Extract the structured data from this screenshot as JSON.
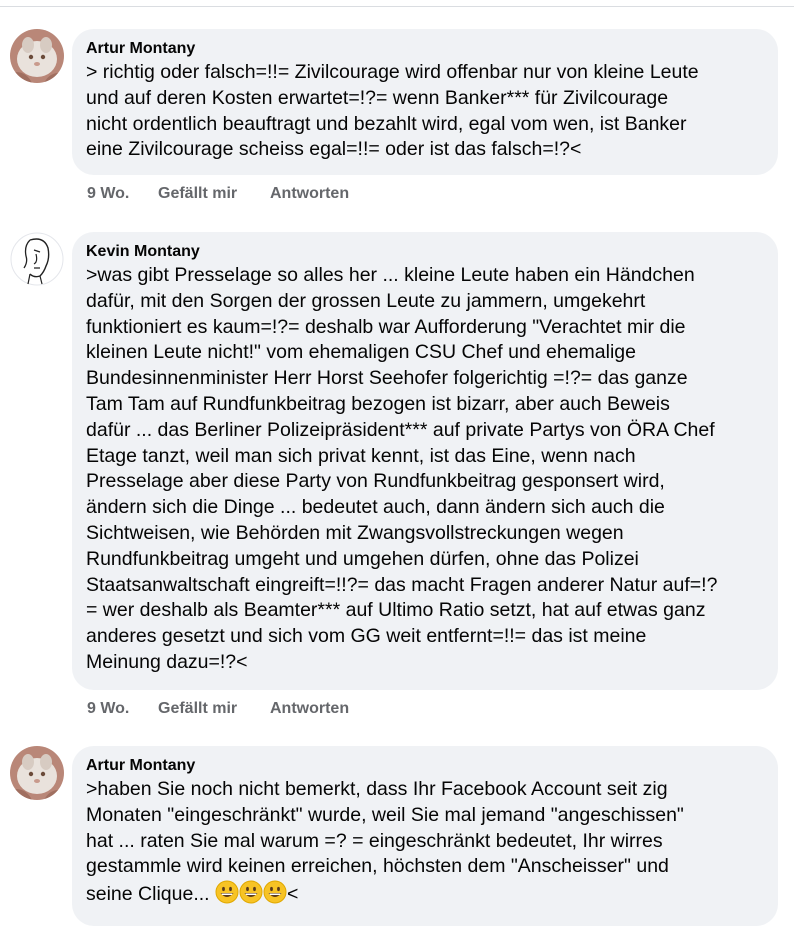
{
  "comments": [
    {
      "author": "Artur Montany",
      "text": "> richtig oder falsch=!!= Zivilcourage wird offenbar nur von kleine Leute\nund auf deren Kosten  erwartet=!?= wenn  Banker***  für Zivilcourage\nnicht ordentlich beauftragt und  bezahlt wird, egal vom wen,  ist Banker\neine Zivilcourage scheiss egal=!!= oder ist das falsch=!?<",
      "time": "9 Wo.",
      "like": "Gefällt mir",
      "reply": "Antworten"
    },
    {
      "author": "Kevin Montany",
      "text": ">was gibt Presselage so alles her ... kleine Leute haben ein Händchen\ndafür, mit den Sorgen der grossen Leute zu jammern, umgekehrt\nfunktioniert es kaum=!?= deshalb war Aufforderung \"Verachtet mir die\nkleinen Leute nicht!\" vom ehemaligen CSU Chef und ehemalige\nBundesinnenminister Herr Horst Seehofer folgerichtig =!?= das ganze\nTam Tam auf Rundfunkbeitrag bezogen ist bizarr, aber auch Beweis\ndafür ... das Berliner Polizeipräsident*** auf private Partys von ÖRA Chef\nEtage tanzt, weil man sich privat kennt, ist das Eine, wenn nach\nPresselage aber diese Party von Rundfunkbeitrag gesponsert wird,\nändern sich die Dinge ... bedeutet auch, dann ändern sich auch die\nSichtweisen, wie Behörden mit Zwangsvollstreckungen wegen\nRundfunkbeitrag umgeht und umgehen dürfen, ohne das Polizei\nStaatsanwaltschaft eingreift=!!?= das macht Fragen anderer Natur auf=!?\n= wer deshalb als Beamter*** auf Ultimo Ratio setzt, hat auf etwas ganz\nanderes gesetzt und sich vom GG weit entfernt=!!= das ist meine\nMeinung dazu=!?<",
      "time": "9 Wo.",
      "like": "Gefällt mir",
      "reply": "Antworten"
    },
    {
      "author": "Artur Montany",
      "text": ">haben Sie noch nicht bemerkt, dass Ihr Facebook Account seit zig\nMonaten \"eingeschränkt\" wurde, weil Sie mal jemand \"angeschissen\"\nhat ... raten Sie mal warum =? = eingeschränkt bedeutet, Ihr wirres\ngestammle wird keinen erreichen, höchsten dem \"Anscheisser\" und",
      "last_line": "seine Clique... ",
      "last_suffix": "<",
      "emoji_icon": "grinning-face-emoji"
    }
  ]
}
